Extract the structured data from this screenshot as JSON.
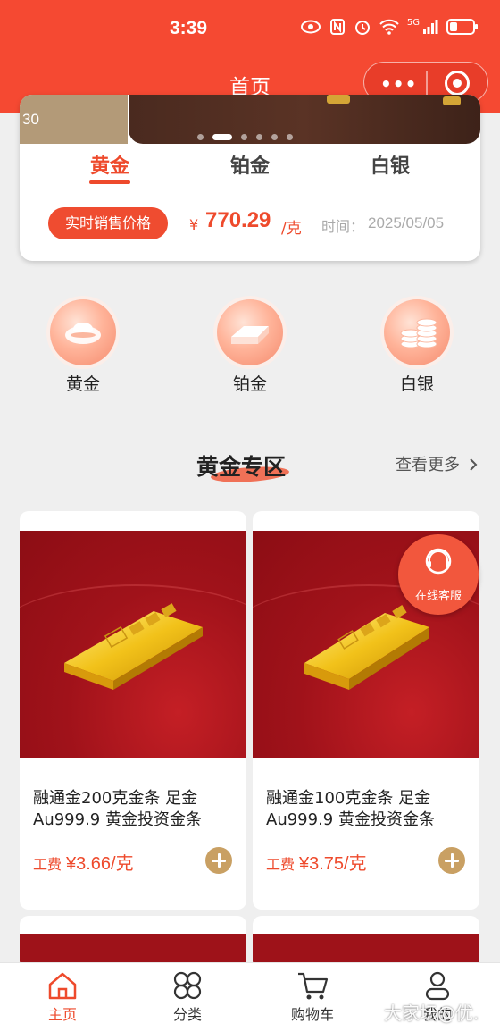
{
  "status_bar": {
    "time": "3:39",
    "network": "5G"
  },
  "navbar": {
    "title": "首页",
    "more_label": "•••"
  },
  "banner": {
    "left_text": "30",
    "dots_total": 6,
    "active_dot": 1
  },
  "metal_tabs": [
    {
      "label": "黄金",
      "active": true
    },
    {
      "label": "铂金",
      "active": false
    },
    {
      "label": "白银",
      "active": false
    }
  ],
  "price": {
    "button_label": "实时销售价格",
    "currency": "¥",
    "value": "770.29",
    "unit": "/克",
    "time_label": "时间：",
    "time": "2025/05/05"
  },
  "categories": [
    {
      "label": "黄金",
      "icon": "gold-ingot-icon"
    },
    {
      "label": "铂金",
      "icon": "platinum-bar-icon"
    },
    {
      "label": "白银",
      "icon": "silver-coins-icon"
    }
  ],
  "section": {
    "title": "黄金专区",
    "see_more": "查看更多"
  },
  "products": [
    {
      "name": "融通金200克金条 足金Au999.9 黄金投资金条",
      "fee_label": "工费",
      "fee": "¥3.66/克"
    },
    {
      "name": "融通金100克金条 足金Au999.9 黄金投资金条",
      "fee_label": "工费",
      "fee": "¥3.75/克"
    }
  ],
  "customer_service": {
    "label": "在线客服"
  },
  "tabbar": [
    {
      "label": "主页",
      "icon": "home-icon",
      "active": true
    },
    {
      "label": "分类",
      "icon": "category-icon",
      "active": false
    },
    {
      "label": "购物车",
      "icon": "cart-icon",
      "active": false
    },
    {
      "label": "我的",
      "icon": "user-icon",
      "active": false
    }
  ],
  "watermark": "大家坛@优.",
  "colors": {
    "brand_red": "#f54932",
    "accent_red": "#ee4a2c",
    "gold_button": "#c9a063"
  }
}
